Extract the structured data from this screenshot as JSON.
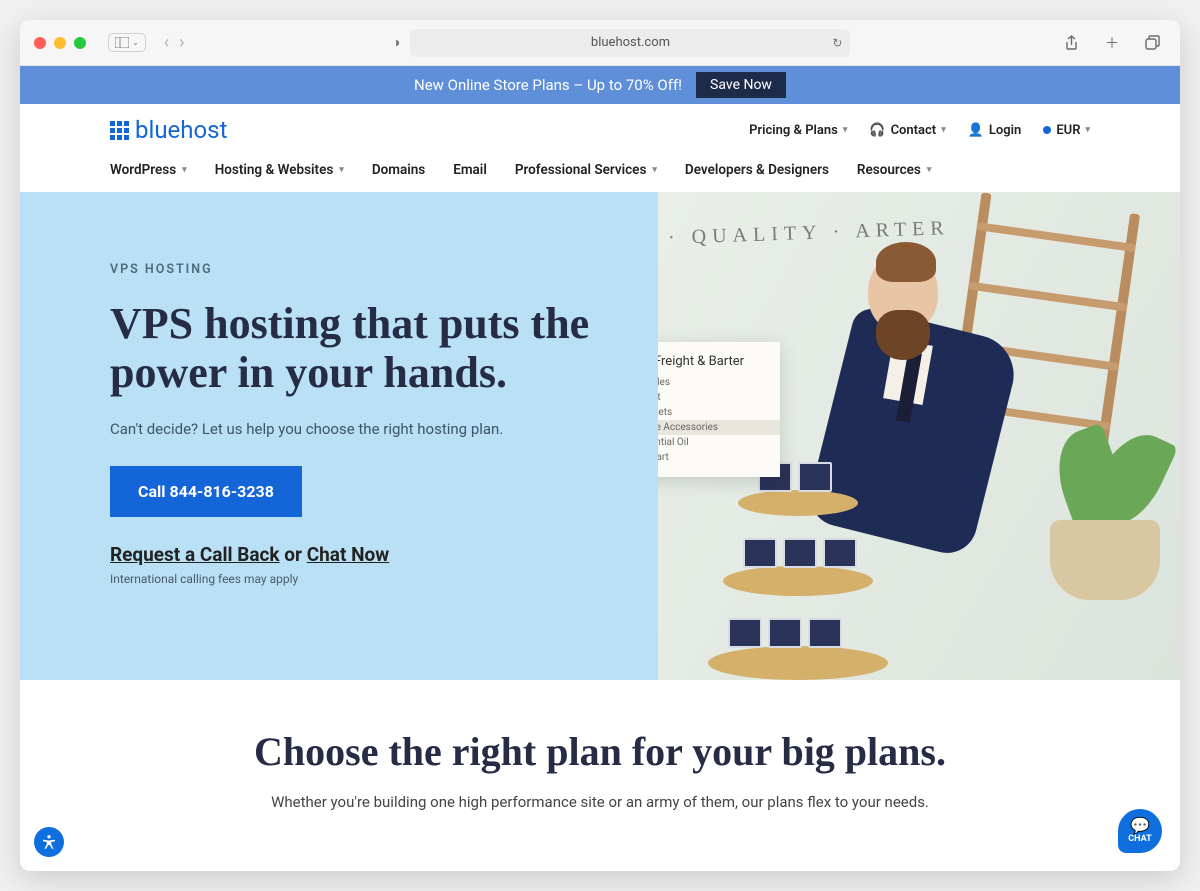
{
  "browser": {
    "url": "bluehost.com"
  },
  "promo": {
    "text": "New Online Store Plans – Up to 70% Off!",
    "button": "Save Now"
  },
  "header": {
    "logo_text": "bluehost",
    "pricing": "Pricing & Plans",
    "contact": "Contact",
    "login": "Login",
    "currency": "EUR"
  },
  "nav": {
    "items": [
      {
        "label": "WordPress",
        "dropdown": true
      },
      {
        "label": "Hosting & Websites",
        "dropdown": true
      },
      {
        "label": "Domains",
        "dropdown": false
      },
      {
        "label": "Email",
        "dropdown": false
      },
      {
        "label": "Professional Services",
        "dropdown": true
      },
      {
        "label": "Developers & Designers",
        "dropdown": false
      },
      {
        "label": "Resources",
        "dropdown": true
      }
    ]
  },
  "hero": {
    "eyebrow": "VPS HOSTING",
    "title": "VPS hosting that puts the power in your hands.",
    "subtitle": "Can't decide? Let us help you choose the right hosting plan.",
    "cta": "Call 844-816-3238",
    "request": "Request a Call Back",
    "or": " or ",
    "chat": "Chat Now",
    "fine": "International calling fees may apply",
    "overlay_brand": "Freight & Barter",
    "overlay_items": [
      "Candles",
      "About",
      "Gift Sets",
      "Home Accessories",
      "Essential Oil",
      "My Cart"
    ],
    "sign": "· QUALITY · ARTER"
  },
  "plans": {
    "title": "Choose the right plan for your big plans.",
    "subtitle": "Whether you're building one high performance site or an army of them, our plans flex to your needs."
  },
  "chat_label": "CHAT"
}
